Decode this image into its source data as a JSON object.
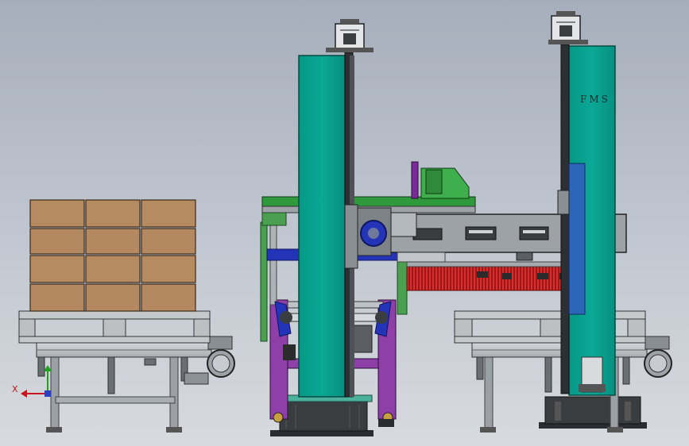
{
  "panel_label": "FMS",
  "axis_triad": {
    "x_label": "X",
    "x_color": "#c8141c",
    "y_color": "#1fa21f",
    "z_color": "#2a3fc4"
  },
  "colors": {
    "background_top": "#a6aebb",
    "background_bottom": "#d7dade",
    "column_teal": "#0a9e8c",
    "carton_brown": "#b58a62",
    "steel_gray": "#b8bcc0",
    "frame_purple": "#8e3fa8",
    "beam_green": "#2f9a3c",
    "motor_blue": "#2434b8",
    "chain_red": "#b01818",
    "dark_steel": "#3a3d40"
  },
  "pallet_load": {
    "columns": 3,
    "rows": 4
  }
}
